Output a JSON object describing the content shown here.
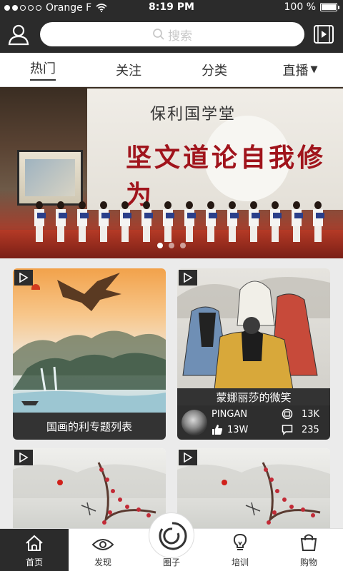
{
  "status_bar": {
    "carrier": "Orange F",
    "time": "8:19 PM",
    "battery": "100 %"
  },
  "header": {
    "search_placeholder": "搜索",
    "user_icon": "user-icon",
    "video_icon": "video-icon"
  },
  "tabs": [
    {
      "label": "热门",
      "active": true
    },
    {
      "label": "关注",
      "active": false
    },
    {
      "label": "分类",
      "active": false
    },
    {
      "label": "直播",
      "active": false,
      "dropdown": true
    }
  ],
  "banner": {
    "subtitle": "保利国学堂",
    "title": "坚文道论自我修为",
    "pages": 3,
    "current_page": 1
  },
  "cards": [
    {
      "caption": "国画的利专题列表"
    },
    {
      "caption": "蒙娜丽莎的微笑",
      "author": "PINGAN",
      "likes": "13W",
      "views": "13K",
      "comments": "235"
    },
    {
      "caption": ""
    },
    {
      "caption": ""
    }
  ],
  "bottom_nav": [
    {
      "label": "首页",
      "icon": "home-icon",
      "active": true
    },
    {
      "label": "发现",
      "icon": "eye-icon",
      "active": false
    },
    {
      "label": "圈子",
      "icon": "circle-icon",
      "active": false
    },
    {
      "label": "培训",
      "icon": "lightbulb-icon",
      "active": false
    },
    {
      "label": "购物",
      "icon": "shopping-bag-icon",
      "active": false
    }
  ],
  "colors": {
    "dark": "#2b2b2b",
    "accent_red": "#a0141c"
  }
}
